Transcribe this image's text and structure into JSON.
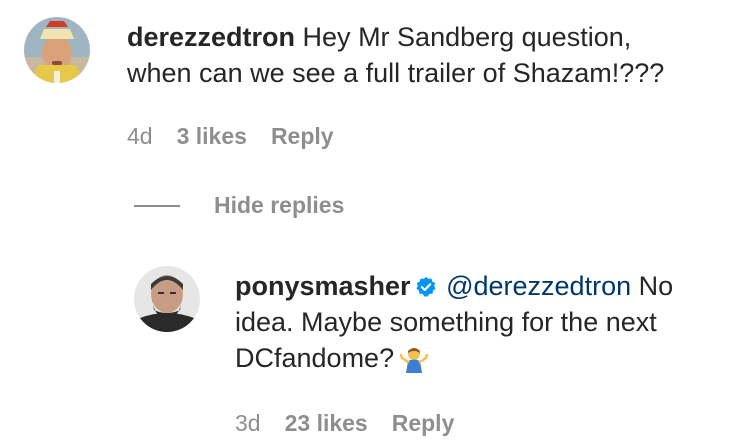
{
  "comment": {
    "username": "derezzedtron",
    "text": "Hey Mr Sandberg question, when can we see a full trailer of Shazam!???",
    "time": "4d",
    "likes": "3 likes",
    "reply_label": "Reply",
    "avatar_icon": "user-avatar-icon"
  },
  "hide_replies_label": "Hide replies",
  "reply": {
    "username": "ponysmasher",
    "verified_icon": "verified-badge-icon",
    "mention": "@derezzedtron",
    "text": "No idea. Maybe something for the next DCfandome?",
    "emoji_icon": "shrug-emoji-icon",
    "time": "3d",
    "likes": "23 likes",
    "reply_label": "Reply",
    "avatar_icon": "user-avatar-icon"
  },
  "colors": {
    "text": "#262626",
    "muted": "#8e8e8e",
    "mention": "#00376b",
    "verified": "#0095f6"
  }
}
